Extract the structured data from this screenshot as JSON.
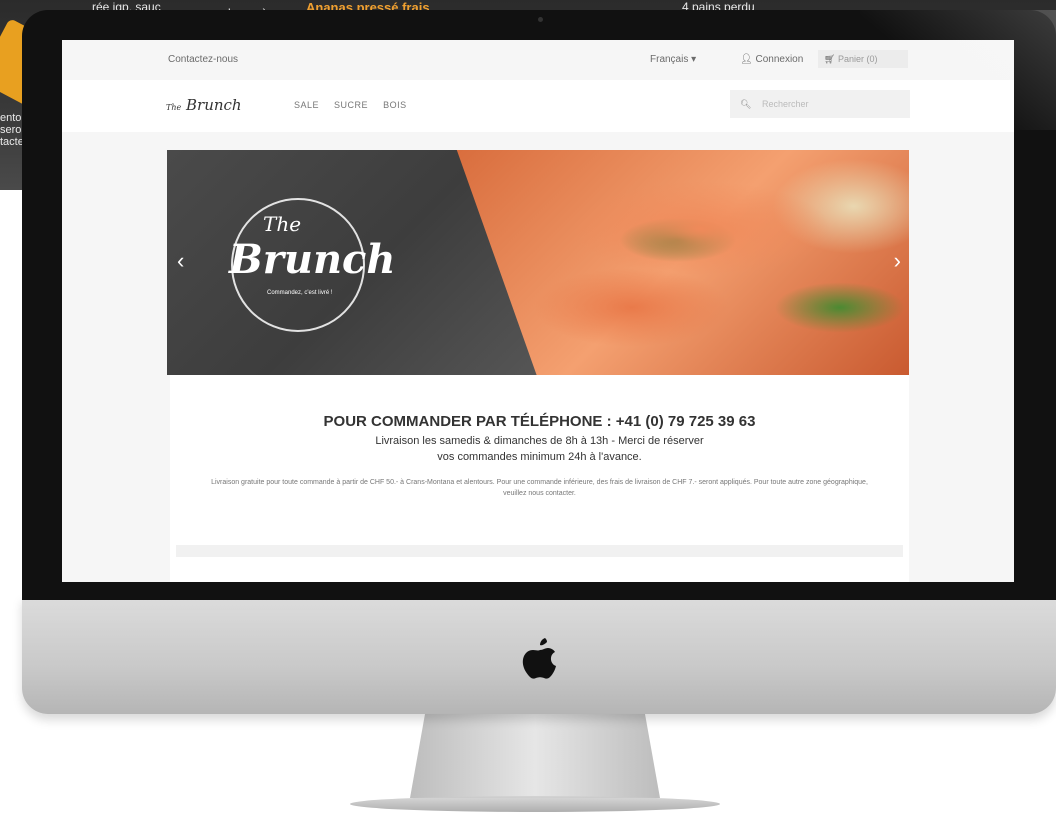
{
  "background": {
    "text_1": "rée igp, sauc",
    "text_2": "beurre)",
    "text_orange": "Ananas pressé frais",
    "text_3": "4 pains perdu",
    "side_lines": [
      "entou",
      "seron",
      "tacte"
    ]
  },
  "topbar": {
    "contact": "Contactez-nous",
    "language": "Français ▾",
    "login": "Connexion",
    "cart": "Panier (0)"
  },
  "navbar": {
    "brand_small": "The",
    "brand": "Brunch",
    "menu": [
      "SALE",
      "SUCRE",
      "BOIS"
    ],
    "search_placeholder": "Rechercher"
  },
  "hero": {
    "logo_the": "The",
    "logo_brunch": "Brunch",
    "logo_tagline": "Commandez, c'est livré !",
    "prev": "‹",
    "next": "›"
  },
  "info": {
    "headline": "POUR COMMANDER PAR TÉLÉPHONE : +41 (0) 79 725 39 63",
    "line1": "Livraison les samedis & dimanches de 8h à 13h - Merci de réserver",
    "line2": "vos commandes minimum 24h à l'avance.",
    "small": "Livraison gratuite pour toute commande à partir de CHF 50.- à Crans-Montana et alentours. Pour une commande inférieure, des frais de livraison de CHF 7.- seront appliqués. Pour toute autre zone géographique, veuillez nous contacter."
  },
  "colors": {
    "accent": "#f0a030",
    "bezel": "#111111",
    "page_bg": "#f6f6f6"
  },
  "icons": [
    "user-icon",
    "cart-icon",
    "search-icon",
    "apple-logo-icon"
  ]
}
